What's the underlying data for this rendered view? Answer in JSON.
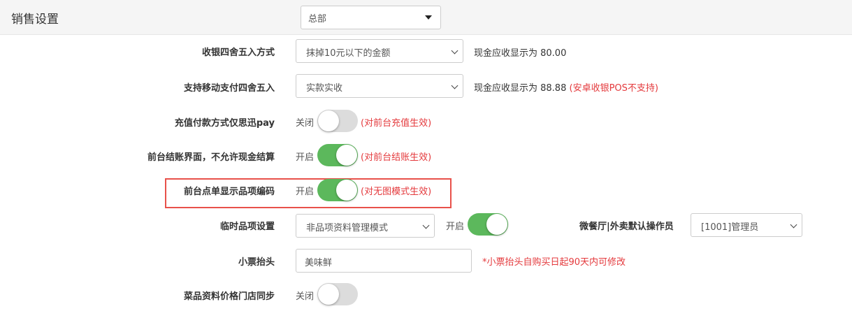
{
  "header": {
    "title": "销售设置",
    "branch_value": "总部"
  },
  "rows": {
    "rounding": {
      "label": "收银四舍五入方式",
      "value": "抹掉10元以下的金额",
      "hint": "现金应收显示为 80.00"
    },
    "mobile_rounding": {
      "label": "支持移动支付四舍五入",
      "value": "实款实收",
      "hint": "现金应收显示为 88.88",
      "note": "(安卓收银POS不支持)"
    },
    "recharge_pay": {
      "label": "充值付款方式仅思迅pay",
      "state": "关闭",
      "on": false,
      "note": "(对前台充值生效)"
    },
    "no_cash": {
      "label": "前台结账界面，不允许现金结算",
      "state": "开启",
      "on": true,
      "note": "(对前台结账生效)"
    },
    "item_code": {
      "label": "前台点单显示品项编码",
      "state": "开启",
      "on": true,
      "note": "(对无图模式生效)"
    },
    "temp_item": {
      "label": "临时品项设置",
      "value": "非品项资料管理模式",
      "state": "开启",
      "on": true,
      "operator_label": "微餐厅|外卖默认操作员",
      "operator_value": "[1001]管理员"
    },
    "receipt": {
      "label": "小票抬头",
      "value": "美味鲜",
      "note": "*小票抬头自购买日起90天内可修改"
    },
    "price_sync": {
      "label": "菜品资料价格门店同步",
      "state": "关闭",
      "on": false
    }
  },
  "colors": {
    "toggle_on": "#5cb85c",
    "toggle_off": "#dcdcdc",
    "warning": "#e4393c",
    "highlight": "#e8514a"
  }
}
